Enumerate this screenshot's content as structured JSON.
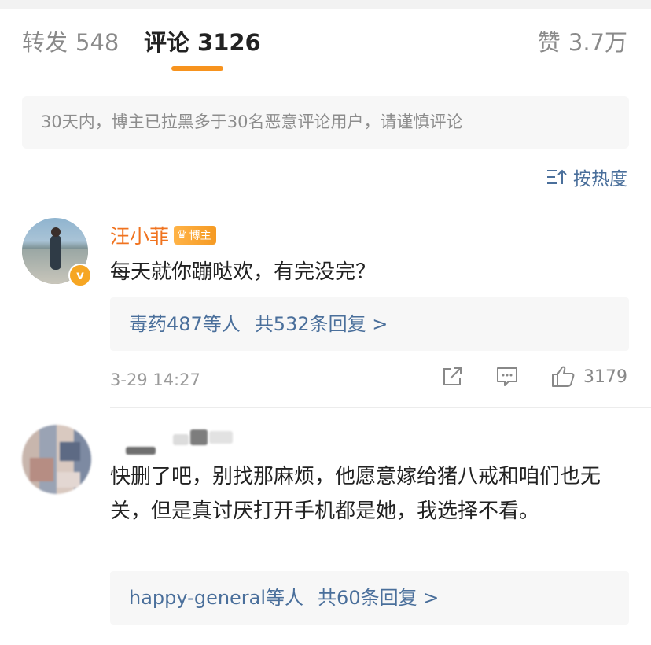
{
  "tabs": {
    "repost_label": "转发",
    "repost_count": "548",
    "comment_label": "评论",
    "comment_count": "3126",
    "like_label": "赞",
    "like_count": "3.7万"
  },
  "notice": "30天内，博主已拉黑多于30名恶意评论用户，请谨慎评论",
  "sort": {
    "label": "按热度",
    "icon": "sort-icon"
  },
  "accent_color": "#f7931e",
  "link_color": "#4a6f9b",
  "comments": [
    {
      "author": "汪小菲",
      "badge": "博主",
      "text": "每天就你蹦哒欢，有完没完？",
      "reply_users": "毒药487等人",
      "reply_count": "共532条回复 >",
      "time": "3-29 14:27",
      "likes": "3179"
    },
    {
      "text": "快删了吧，别找那麻烦，他愿意嫁给猪八戒和咱们也无关，但是真讨厌打开手机都是她，我选择不看。",
      "reply_users": "happy-general等人",
      "reply_count": "共60条回复 >"
    }
  ]
}
